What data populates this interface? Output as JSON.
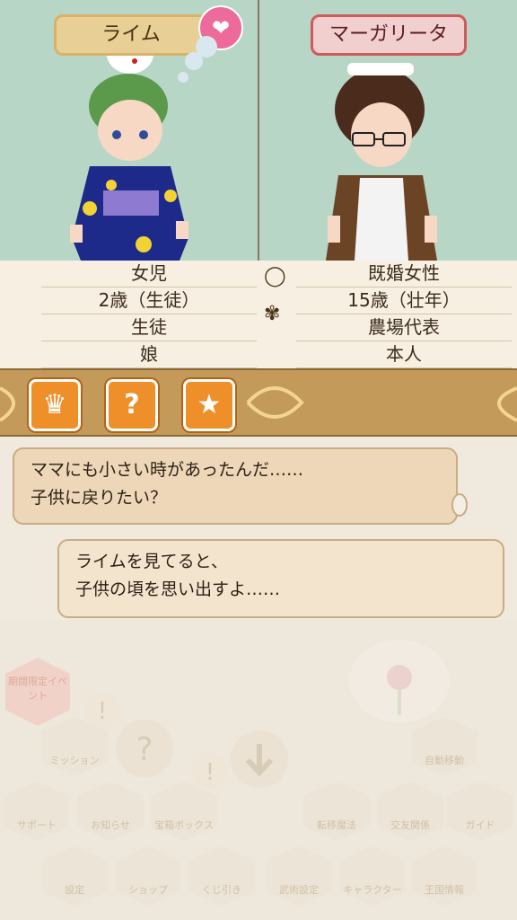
{
  "left_character": {
    "name": "ライム",
    "info": [
      "女児",
      "2歳（生徒）",
      "生徒",
      "娘"
    ]
  },
  "right_character": {
    "name": "マーガリータ",
    "info": [
      "既婚女性",
      "15歳（壮年）",
      "農場代表",
      "本人"
    ]
  },
  "icons": {
    "heart": "heart-icon",
    "ring": "ring-icon",
    "wheat": "wheat-icon",
    "toolbar": [
      "clothes-icon",
      "question-icon",
      "star-icon"
    ]
  },
  "dialogue": [
    {
      "lines": [
        "ママにも小さい時があったんだ……",
        "子供に戻りたい？"
      ]
    },
    {
      "lines": [
        "ライムを見てると、",
        "子供の頃を思い出すよ……"
      ]
    }
  ],
  "menu": {
    "event": "期間限定イベント",
    "items": [
      "ミッション",
      "自動移動",
      "サポート",
      "お知らせ",
      "宝箱ボックス",
      "転移魔法",
      "交友関係",
      "ガイド",
      "設定",
      "ショップ",
      "くじ引き",
      "武術設定",
      "キャラクター",
      "王国情報"
    ]
  },
  "colors": {
    "panel_bg": "#b7d6c6",
    "name_tag_left": "#e7cf95",
    "name_tag_right": "#d05a5a",
    "accent_orange": "#ef8f2a",
    "heart_pink": "#ec6b9b"
  }
}
